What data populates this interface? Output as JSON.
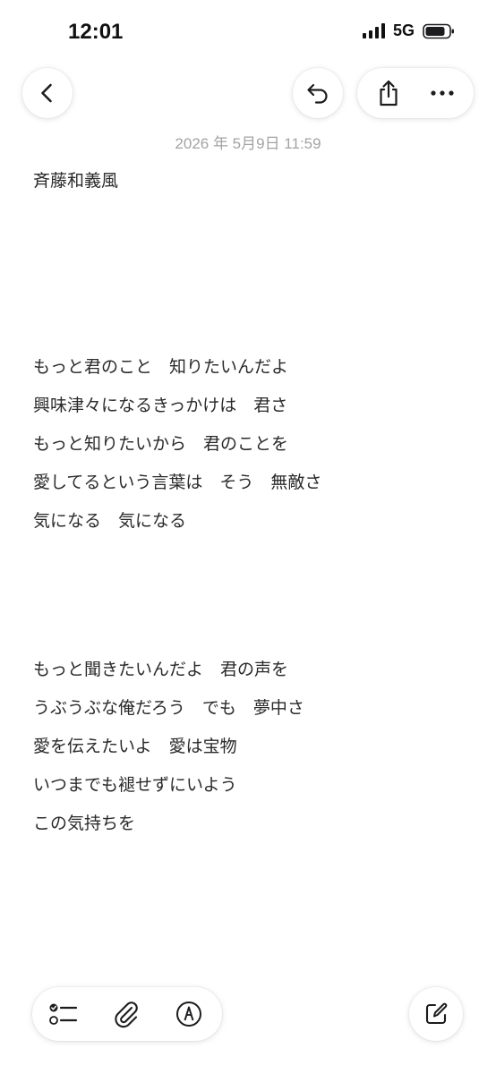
{
  "status_bar": {
    "time": "12:01",
    "network": "5G",
    "icons": [
      "signal-bars-icon",
      "battery-icon"
    ]
  },
  "toolbar": {
    "icons": [
      "back-chevron-icon",
      "undo-icon",
      "share-icon",
      "more-icon"
    ]
  },
  "note": {
    "timestamp": "2026 年 5月9日 11:59",
    "title": "斉藤和義風",
    "verse1": [
      "もっと君のこと　知りたいんだよ",
      "興味津々になるきっかけは　君さ",
      "もっと知りたいから　君のことを",
      "愛してるという言葉は　そう　無敵さ",
      "気になる　気になる"
    ],
    "verse2": [
      "もっと聞きたいんだよ　君の声を",
      "うぶうぶな俺だろう　でも　夢中さ",
      "愛を伝えたいよ　愛は宝物",
      "いつまでも褪せずにいよう",
      "この気持ちを"
    ]
  },
  "bottom_bar": {
    "icons": [
      "checklist-icon",
      "paperclip-icon",
      "markup-pen-icon",
      "compose-icon"
    ]
  },
  "colors": {
    "background": "#ffffff",
    "text": "#2a2a2a",
    "timestamp": "#a3a3a3",
    "icon": "#1c1c1e"
  }
}
